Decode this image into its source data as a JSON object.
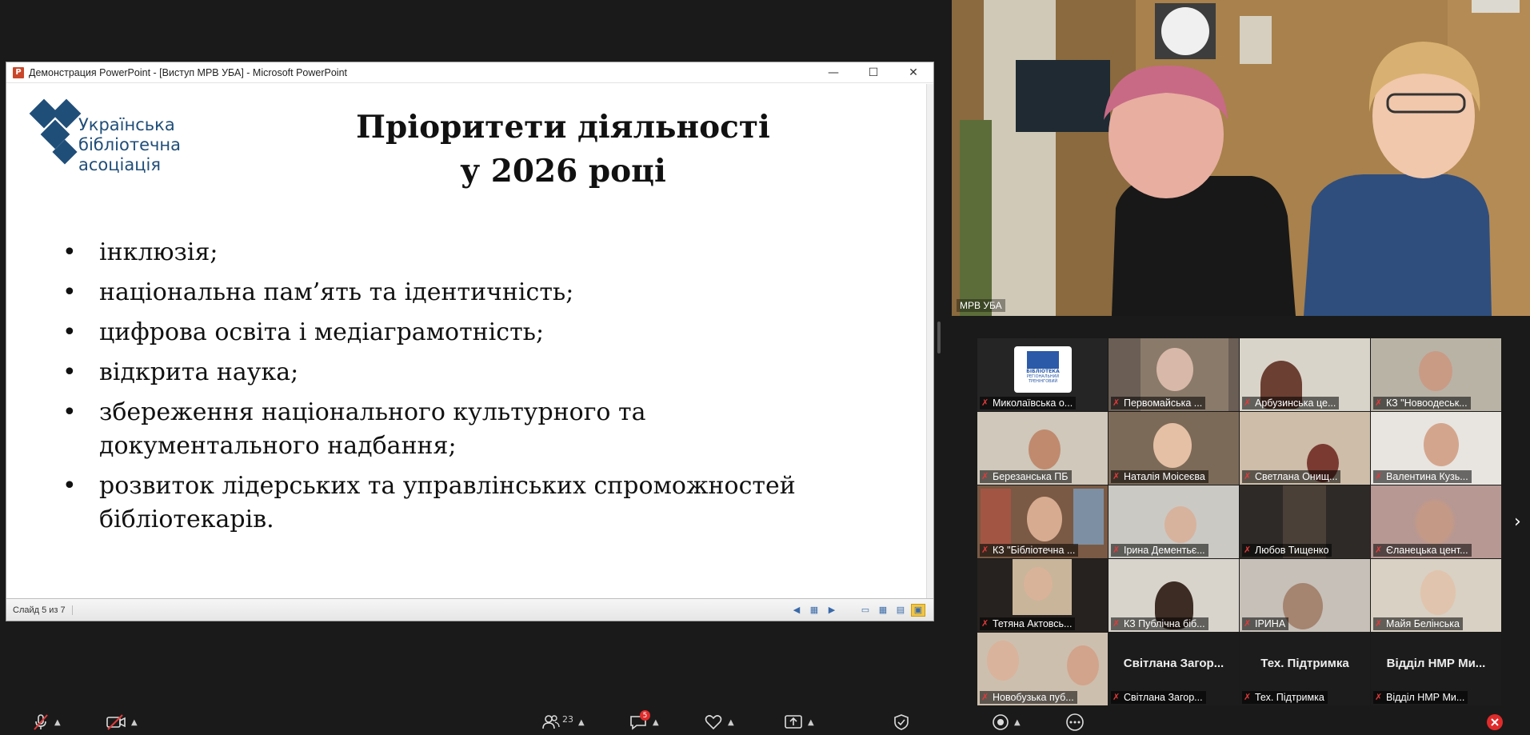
{
  "ppt": {
    "window_title": "Демонстрация PowerPoint - [Виступ МРВ УБА] - Microsoft PowerPoint",
    "app_icon": "P",
    "minimize": "—",
    "maximize": "☐",
    "close": "✕",
    "status": "Слайд 5 из 7"
  },
  "slide": {
    "logo_lines": [
      "Українська",
      "бібліотечна",
      "асоціація"
    ],
    "title_line1": "Пріоритети діяльності",
    "title_line2": "у 2026 році",
    "bullets": [
      "інклюзія;",
      "національна пам’ять та ідентичність;",
      "цифрова освіта і медіаграмотність;",
      "відкрита наука;",
      "збереження національного культурного та документального надбання;",
      "розвиток лідерських та управлінських спроможностей бібліотекарів."
    ],
    "logo_color": "#1f4e79"
  },
  "speaker": {
    "name": "МРВ УБА"
  },
  "gallery": {
    "participants": [
      "Миколаївська о...",
      "Первомайська ...",
      "Арбузинська це...",
      "КЗ \"Новоодеськ...",
      "Березанська ПБ",
      "Наталія Моісеєва",
      "Светлана Онищ...",
      "Валентина Кузь...",
      "КЗ \"Бібліотечна ...",
      "Ірина Дементьє...",
      "Любов Тищенко",
      "Єланецька цент...",
      "Тетяна Актовсь...",
      "КЗ Публічна біб...",
      "ІРИНА",
      "Майя Белінська",
      "Новобузька пуб...",
      "Світлана Загор...",
      "Тех. Підтримка",
      "Відділ НМР Ми..."
    ],
    "big_names": {
      "t17": "Світлана Загор...",
      "t18": "Тех. Підтримка",
      "t19": "Відділ НМР Ми..."
    },
    "logo_tile_text": [
      "БІБЛІОТЕКА",
      "РЕГІОНАЛЬНИЙ",
      "ТРЕНІНГОВИЙ"
    ]
  },
  "toolbar": {
    "participants_count": "23",
    "chat_badge": "5"
  },
  "colors": {
    "mic_off": "#e23a3a",
    "badge": "#e02b2b"
  }
}
